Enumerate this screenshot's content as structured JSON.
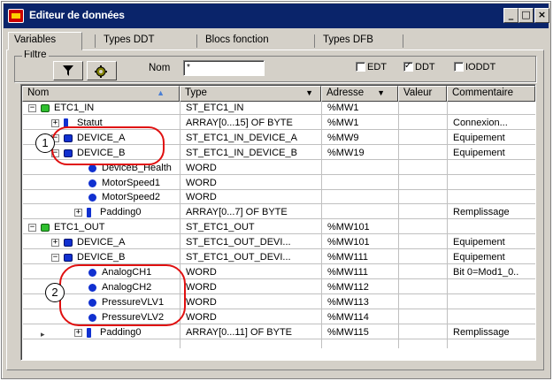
{
  "window": {
    "title": "Editeur de données",
    "minimize": "_",
    "maximize": "□",
    "close": "×"
  },
  "tabs": [
    "Variables",
    "Types DDT",
    "Blocs fonction",
    "Types DFB"
  ],
  "filter": {
    "group_label": "Filtre",
    "name_label": "Nom",
    "name_value": "*",
    "edt_label": "EDT",
    "ddt_label": "DDT",
    "ioddt_label": "IODDT",
    "edt_checked": false,
    "ddt_checked": true,
    "ioddt_checked": false
  },
  "columns": {
    "name": "Nom",
    "type": "Type",
    "address": "Adresse",
    "value": "Valeur",
    "comment": "Commentaire"
  },
  "rows": [
    {
      "name": "ETC1_IN",
      "type": "ST_ETC1_IN",
      "address": "%MW1",
      "comment": ""
    },
    {
      "name": "Statut",
      "type": "ARRAY[0...15] OF BYTE",
      "address": "%MW1",
      "comment": "Connexion..."
    },
    {
      "name": "DEVICE_A",
      "type": "ST_ETC1_IN_DEVICE_A",
      "address": "%MW9",
      "comment": "Equipement"
    },
    {
      "name": "DEVICE_B",
      "type": "ST_ETC1_IN_DEVICE_B",
      "address": "%MW19",
      "comment": "Equipement"
    },
    {
      "name": "DeviceB_Health",
      "type": "WORD",
      "address": "",
      "comment": ""
    },
    {
      "name": "MotorSpeed1",
      "type": "WORD",
      "address": "",
      "comment": ""
    },
    {
      "name": "MotorSpeed2",
      "type": "WORD",
      "address": "",
      "comment": ""
    },
    {
      "name": "Padding0",
      "type": "ARRAY[0...7] OF BYTE",
      "address": "",
      "comment": "Remplissage"
    },
    {
      "name": "ETC1_OUT",
      "type": "ST_ETC1_OUT",
      "address": "%MW101",
      "comment": ""
    },
    {
      "name": "DEVICE_A",
      "type": "ST_ETC1_OUT_DEVI...",
      "address": "%MW101",
      "comment": "Equipement"
    },
    {
      "name": "DEVICE_B",
      "type": "ST_ETC1_OUT_DEVI...",
      "address": "%MW111",
      "comment": "Equipement"
    },
    {
      "name": "AnalogCH1",
      "type": "WORD",
      "address": "%MW111",
      "comment": "Bit 0=Mod1_0.."
    },
    {
      "name": "AnalogCH2",
      "type": "WORD",
      "address": "%MW112",
      "comment": ""
    },
    {
      "name": "PressureVLV1",
      "type": "WORD",
      "address": "%MW113",
      "comment": ""
    },
    {
      "name": "PressureVLV2",
      "type": "WORD",
      "address": "%MW114",
      "comment": ""
    },
    {
      "name": "Padding0",
      "type": "ARRAY[0...11] OF BYTE",
      "address": "%MW115",
      "comment": "Remplissage"
    }
  ],
  "callouts": [
    "1",
    "2"
  ]
}
